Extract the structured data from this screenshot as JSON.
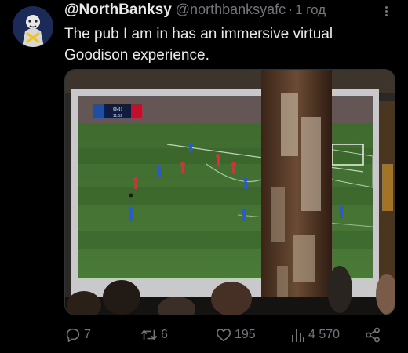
{
  "tweet": {
    "display_name": "@NorthBanksy",
    "handle": "@northbanksyafc",
    "separator": "·",
    "time": "1 год",
    "text_line1": "The pub I am in has an immersive virtual",
    "text_line2": "Goodison experience."
  },
  "media": {
    "scoreboard_score": "0-0",
    "scoreboard_clock": "11:52"
  },
  "actions": {
    "replies": "7",
    "retweets": "6",
    "likes": "195",
    "views": "4 570"
  },
  "icons": {
    "reply": "reply-icon",
    "retweet": "retweet-icon",
    "like": "heart-icon",
    "views": "views-icon",
    "share": "share-icon",
    "more": "more-icon"
  },
  "colors": {
    "background": "#000000",
    "primary_text": "#e7e9ea",
    "secondary_text": "#71767b"
  }
}
